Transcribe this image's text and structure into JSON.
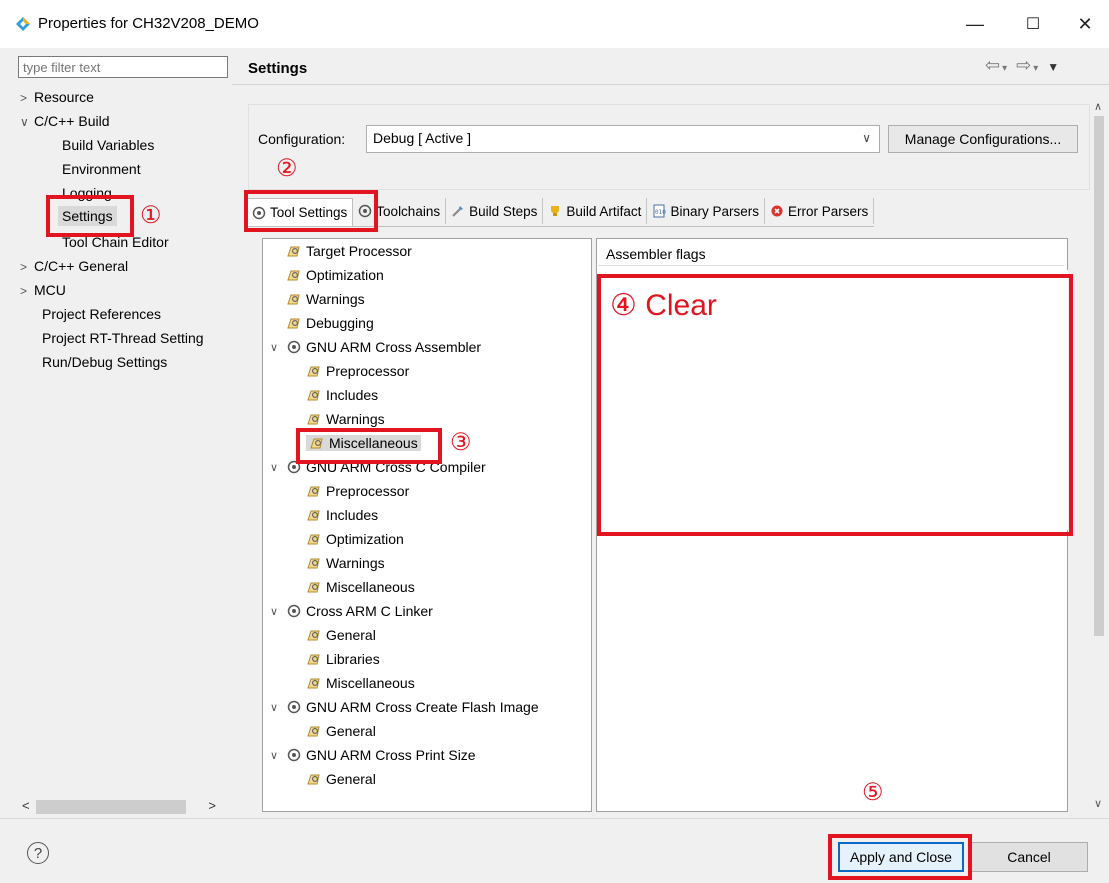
{
  "window": {
    "title": "Properties for CH32V208_DEMO",
    "min": "—",
    "max": "☐",
    "close": "✕"
  },
  "filter": {
    "placeholder": "type filter text"
  },
  "nav": {
    "resource": "Resource",
    "cc_build": "C/C++ Build",
    "build_variables": "Build Variables",
    "environment": "Environment",
    "logging": "Logging",
    "settings": "Settings",
    "tool_chain_editor": "Tool Chain Editor",
    "cc_general": "C/C++ General",
    "mcu": "MCU",
    "project_references": "Project References",
    "project_rtthread": "Project RT-Thread Setting",
    "run_debug": "Run/Debug Settings"
  },
  "header": {
    "title": "Settings"
  },
  "config": {
    "label": "Configuration:",
    "value": "Debug  [ Active ]",
    "manage": "Manage Configurations..."
  },
  "tabs": [
    "Tool Settings",
    "Toolchains",
    "Build Steps",
    "Build Artifact",
    "Binary Parsers",
    "Error Parsers"
  ],
  "tree": {
    "target_processor": "Target Processor",
    "optimization": "Optimization",
    "warnings": "Warnings",
    "debugging": "Debugging",
    "assembler": "GNU ARM Cross Assembler",
    "asm_preprocessor": "Preprocessor",
    "asm_includes": "Includes",
    "asm_warnings": "Warnings",
    "asm_misc": "Miscellaneous",
    "c_compiler": "GNU ARM Cross C Compiler",
    "cc_preprocessor": "Preprocessor",
    "cc_includes": "Includes",
    "cc_optimization": "Optimization",
    "cc_warnings": "Warnings",
    "cc_misc": "Miscellaneous",
    "linker": "Cross ARM C Linker",
    "ld_general": "General",
    "ld_libraries": "Libraries",
    "ld_misc": "Miscellaneous",
    "flash": "GNU ARM Cross Create Flash Image",
    "flash_general": "General",
    "print_size": "GNU ARM Cross Print Size",
    "ps_general": "General"
  },
  "flags": {
    "label": "Assembler flags",
    "value": ""
  },
  "annotations": {
    "a1": "①",
    "a2": "②",
    "a3": "③",
    "a4": "④ Clear",
    "a5": "⑤"
  },
  "buttons": {
    "help": "?",
    "apply": "Apply and Close",
    "cancel": "Cancel"
  },
  "colors": {
    "annotation_red": "#e1141f",
    "focus_blue": "#0a68c6"
  }
}
